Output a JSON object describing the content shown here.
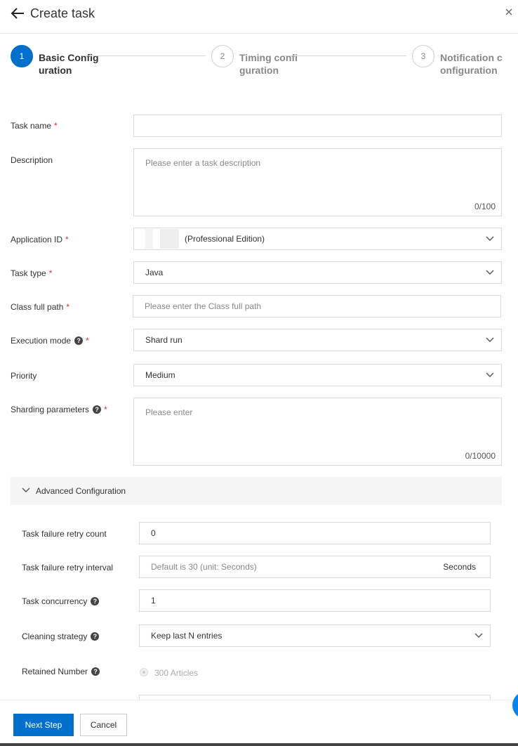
{
  "header": {
    "title": "Create task"
  },
  "steps": [
    {
      "number": "1",
      "label": "Basic Configuration"
    },
    {
      "number": "2",
      "label": "Timing configuration"
    },
    {
      "number": "3",
      "label": "Notification configuration"
    }
  ],
  "form": {
    "task_name": {
      "label": "Task name",
      "value": ""
    },
    "description": {
      "label": "Description",
      "placeholder": "Please enter a task description",
      "count": "0/100"
    },
    "application_id": {
      "label": "Application ID",
      "value": "(Professional Edition)"
    },
    "task_type": {
      "label": "Task type",
      "value": "Java"
    },
    "class_full_path": {
      "label": "Class full path",
      "placeholder": "Please enter the Class full path"
    },
    "execution_mode": {
      "label": "Execution mode",
      "value": "Shard run"
    },
    "priority": {
      "label": "Priority",
      "value": "Medium"
    },
    "sharding_parameters": {
      "label": "Sharding parameters",
      "placeholder": "Please enter",
      "count": "0/10000"
    }
  },
  "advanced": {
    "title": "Advanced Configuration",
    "retry_count": {
      "label": "Task failure retry count",
      "value": "0"
    },
    "retry_interval": {
      "label": "Task failure retry interval",
      "placeholder": "Default is 30 (unit: Seconds)",
      "unit": "Seconds"
    },
    "concurrency": {
      "label": "Task concurrency",
      "value": "1"
    },
    "cleaning_strategy": {
      "label": "Cleaning strategy",
      "value": "Keep last N entries"
    },
    "retained_number": {
      "label": "Retained Number",
      "option": "300 Articles"
    }
  },
  "footer": {
    "next_label": "Next Step",
    "cancel_label": "Cancel"
  },
  "colors": {
    "primary": "#0070cc",
    "required": "#d93026",
    "border": "#dcdcdc"
  },
  "icons": {
    "back": "arrow-left-icon",
    "close": "close-icon",
    "help": "question-circle-icon",
    "dropdown": "chevron-down-icon"
  }
}
